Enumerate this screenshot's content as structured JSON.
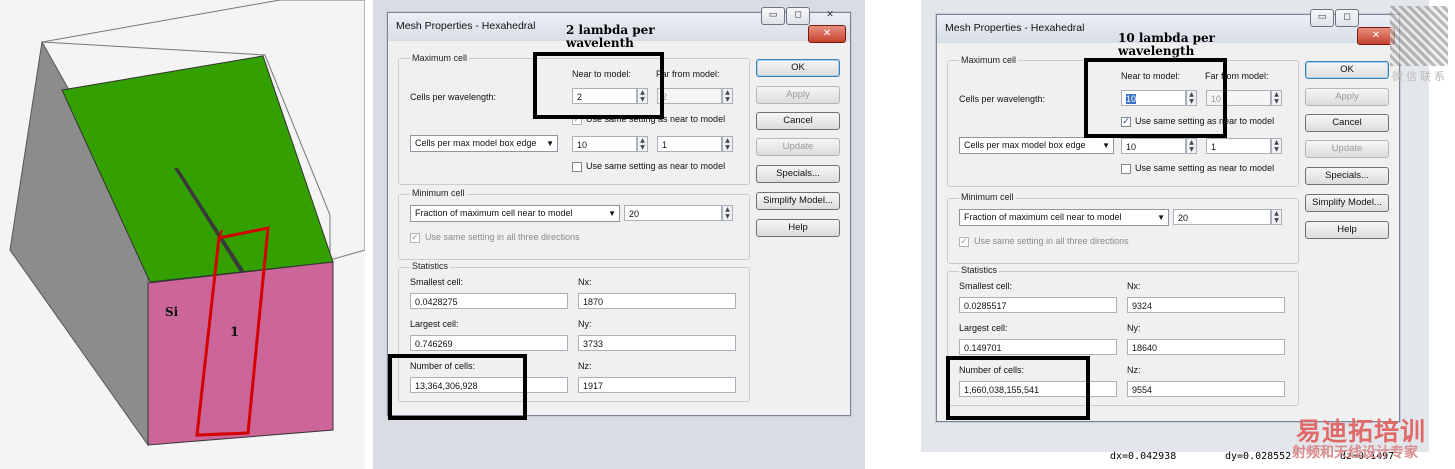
{
  "model": {
    "material_label": "Si",
    "region_label": "1",
    "colors": {
      "top": "#339900",
      "front": "#cc6699",
      "side": "#888888",
      "outline": "#cc0000"
    }
  },
  "dialogs": [
    {
      "title": "Mesh Properties - Hexahedral",
      "annotation": "2 lambda per wavelenth",
      "maximum_cell": {
        "group_label": "Maximum cell",
        "near_header": "Near to model:",
        "far_header": "Far from model:",
        "cells_per_wavelength_label": "Cells per wavelength:",
        "near_value": "2",
        "far_value": "2",
        "same_setting_label": "Use same setting as near to model",
        "box_edge_combo": "Cells per max model box edge",
        "box_near_value": "10",
        "box_far_value": "1",
        "box_same_setting_label": "Use same setting as near to model"
      },
      "minimum_cell": {
        "group_label": "Minimum cell",
        "combo": "Fraction of maximum cell near to model",
        "value": "20",
        "three_dirs_label": "Use same setting in all three directions"
      },
      "statistics": {
        "group_label": "Statistics",
        "smallest_label": "Smallest cell:",
        "smallest_value": "0.0428275",
        "largest_label": "Largest cell:",
        "largest_value": "0.746269",
        "count_label": "Number of cells:",
        "count_value": "13,364,306,928",
        "nx_label": "Nx:",
        "nx_value": "1870",
        "ny_label": "Ny:",
        "ny_value": "3733",
        "nz_label": "Nz:",
        "nz_value": "1917"
      },
      "buttons": {
        "ok": "OK",
        "apply": "Apply",
        "cancel": "Cancel",
        "update": "Update",
        "specials": "Specials...",
        "simplify": "Simplify Model...",
        "help": "Help"
      }
    },
    {
      "title": "Mesh Properties - Hexahedral",
      "annotation": "10 lambda per wavelength",
      "maximum_cell": {
        "group_label": "Maximum cell",
        "near_header": "Near to model:",
        "far_header": "Far from model:",
        "cells_per_wavelength_label": "Cells per wavelength:",
        "near_value": "10",
        "far_value": "10",
        "same_setting_label": "Use same setting as near to model",
        "box_edge_combo": "Cells per max model box edge",
        "box_near_value": "10",
        "box_far_value": "1",
        "box_same_setting_label": "Use same setting as near to model"
      },
      "minimum_cell": {
        "group_label": "Minimum cell",
        "combo": "Fraction of maximum cell near to model",
        "value": "20",
        "three_dirs_label": "Use same setting in all three directions"
      },
      "statistics": {
        "group_label": "Statistics",
        "smallest_label": "Smallest cell:",
        "smallest_value": "0.0285517",
        "largest_label": "Largest cell:",
        "largest_value": "0.149701",
        "count_label": "Number of cells:",
        "count_value": "1,660,038,155,541",
        "nx_label": "Nx:",
        "nx_value": "9324",
        "ny_label": "Ny:",
        "ny_value": "18640",
        "nz_label": "Nz:",
        "nz_value": "9554"
      },
      "buttons": {
        "ok": "OK",
        "apply": "Apply",
        "cancel": "Cancel",
        "update": "Update",
        "specials": "Specials...",
        "simplify": "Simplify Model...",
        "help": "Help"
      }
    }
  ],
  "status": {
    "dx": "dx=0.042938",
    "dy": "dy=0.028552",
    "dz": "dz=0.1497"
  },
  "watermark": {
    "brand": "易迪拓培训",
    "tagline": "射频和天线设计专家",
    "qr_caption": "微信联系"
  }
}
